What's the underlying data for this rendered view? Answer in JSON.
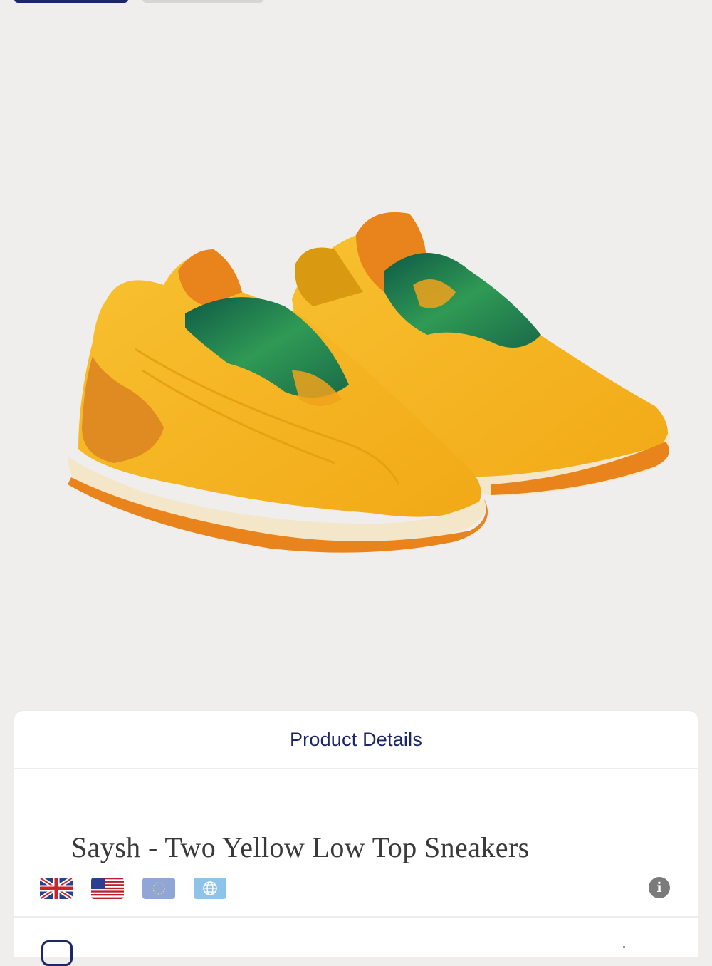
{
  "gallery": {
    "active_tab_index": 0,
    "image_alt_subject": "yellow-sneakers-pair"
  },
  "colors": {
    "accent": "#1c2766",
    "background": "#f0eeed",
    "card": "#ffffff",
    "shoe_yellow": "#f5b51e",
    "shoe_orange": "#e9841c",
    "lace_green": "#1f7a4c",
    "info_icon": "#7b7b7b"
  },
  "details_card": {
    "title": "Product Details",
    "product_name": "Saysh - Two Yellow Low Top Sneakers",
    "size_regions": [
      {
        "name": "UK",
        "icon": "uk-flag-icon"
      },
      {
        "name": "US",
        "icon": "us-flag-icon"
      },
      {
        "name": "EU",
        "icon": "eu-flag-icon"
      },
      {
        "name": "International",
        "icon": "globe-flag-icon"
      }
    ],
    "info_icon": "info-icon"
  }
}
